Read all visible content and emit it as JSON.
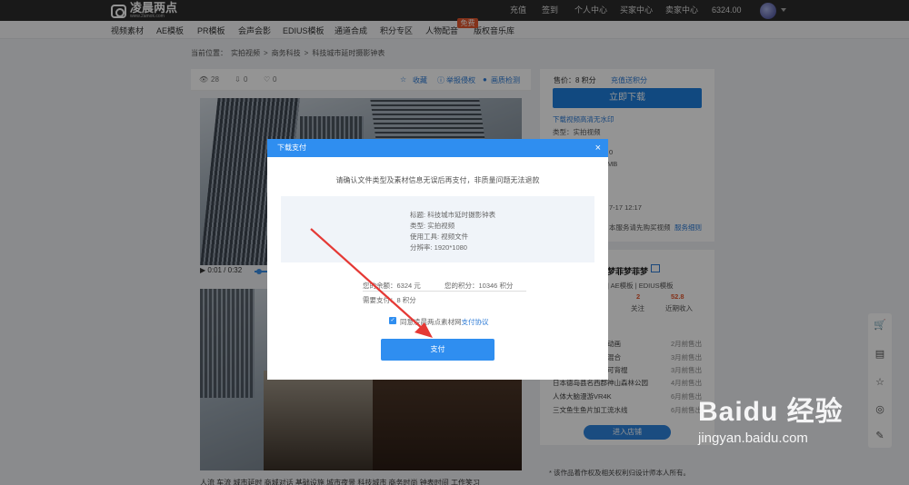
{
  "site": {
    "logo_text": "凌晨两点",
    "logo_sub": "www.2amok.com"
  },
  "topnav": [
    "充值",
    "签到",
    "个人中心",
    "买家中心",
    "卖家中心",
    "6324.00"
  ],
  "categories": [
    "视频素材",
    "AE模板",
    "PR模板",
    "会声会影",
    "EDIUS模板",
    "通道合成",
    "积分专区",
    "人物配音",
    "版权音乐库"
  ],
  "free_badge": "免费",
  "breadcrumb": [
    "当前位置：",
    "实拍视频",
    ">",
    "商务科技",
    ">",
    "科技城市延时摄影钟表"
  ],
  "stats": {
    "views": "28",
    "downloads": "0",
    "likes": "0",
    "favorite": "收藏",
    "report": "举报侵权",
    "quality": "画质检测"
  },
  "player": {
    "time": "0:01 / 0:32"
  },
  "purchase": {
    "price_label": "售价：8 积分",
    "recharge_link": "充值送积分",
    "download_button": "立即下载",
    "watermark_note": "下载视频高清无水印",
    "type": "类型：实拍视频",
    "partial_1": "0",
    "partial_2": "MB",
    "date_partial": "7-17 12:17",
    "service_note": "本服务请先购买视频",
    "service_link": "服务细则"
  },
  "seller": {
    "name": "梦菲梦菲梦",
    "tags": "| AE模板 | EDIUS模板",
    "stat1_value": "2",
    "stat1_label": "关注",
    "stat2_value": "52.8",
    "stat2_label": "近期收入",
    "items": [
      {
        "title": "动画",
        "date": "2月前售出"
      },
      {
        "title": "混合",
        "date": "3月前售出"
      },
      {
        "title": "可背棍",
        "date": "3月前售出"
      },
      {
        "title": "日本德岛县名西郡神山森林公园",
        "date": "4月前售出"
      },
      {
        "title": "人体大脑漫游VR4K",
        "date": "6月前售出"
      },
      {
        "title": "三文鱼生鱼片加工流水线",
        "date": "6月前售出"
      }
    ],
    "shop_button": "进入店铺"
  },
  "copyright": "* 该作品着作权及相关权利归设计师本人所有。",
  "bottom_tags": "人流  车流  城市延时  商城对话  基础设施  城市夜景  科技城市  商务时尚  钟表时间  工作笑习",
  "modal": {
    "title": "下载支付",
    "close": "×",
    "confirm_text": "请确认文件类型及素材信息无误后再支付，非质量问题无法退款",
    "info": [
      "标题: 科技城市延时摄影钟表",
      "类型: 实拍视频",
      "使用工具: 视频文件",
      "分辨率: 1920*1080"
    ],
    "balance": "您的余额：6324 元",
    "points": "您的积分：10346 积分",
    "need_pay": "需要支付：8 积分",
    "agree_prefix": "同意凌晨两点素材网",
    "agree_link": "支付协议",
    "pay_button": "支付"
  },
  "watermark": {
    "main": "Baidu 经验",
    "sub": "jingyan.baidu.com"
  },
  "colors": {
    "accent": "#2f8ef0",
    "topbar": "#2b2b2b",
    "arrow": "#e53935",
    "badge": "#e4572e"
  }
}
